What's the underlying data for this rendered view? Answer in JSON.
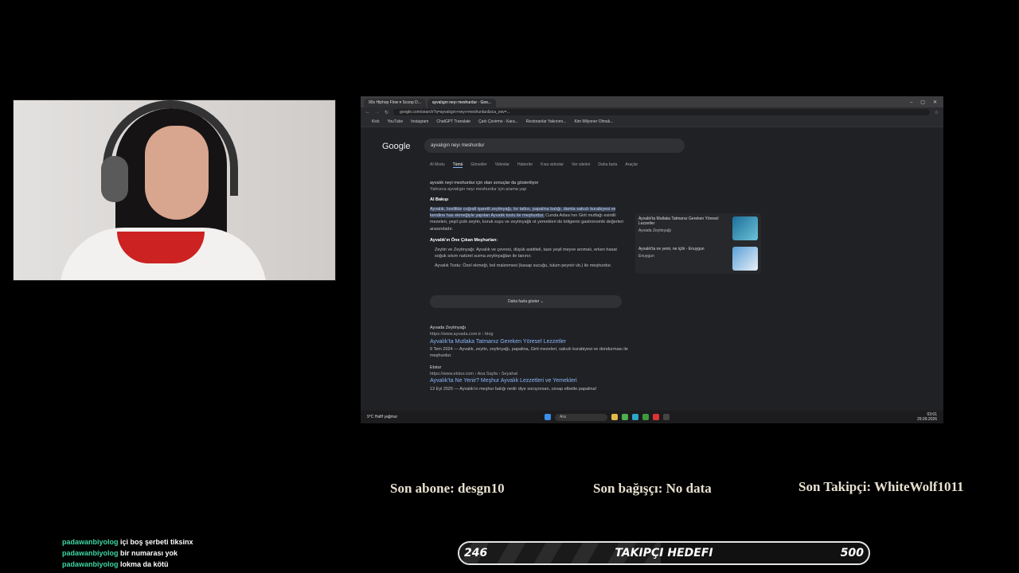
{
  "stream": {
    "last_sub": "Son abone: desgn10",
    "last_donor": "Son bağışçı: No data",
    "last_follower": "Son Takipçi: WhiteWolf1011",
    "goal": {
      "current": "246",
      "title": "TAKIPÇI HEDEFI",
      "target": "500",
      "progress": 0.492
    },
    "chat": [
      {
        "user": "padawanbiyolog",
        "msg": "içi boş şerbeti tiksinx"
      },
      {
        "user": "padawanbiyolog",
        "msg": "bir numarası yok"
      },
      {
        "user": "padawanbiyolog",
        "msg": "lokma da kötü"
      }
    ]
  },
  "browser": {
    "tabs": [
      "90s Hiphop Flow ▾ Scoop D...",
      "ayvalıgın neyı meshurdur - Goo..."
    ],
    "url": "google.com/search?q=ayvalıgın+neyı+meshurdur&sca_esv=...",
    "bookmarks": [
      "Kick",
      "YouTube",
      "Instagram",
      "ChatGPT Translate",
      "Çarlı Çevirme - Kara...",
      "Restoranlar Yakınımı...",
      "Kim Milyoner Olmak..."
    ],
    "search_query": "ayvalıgın neyı meshurdur",
    "logo": "Google",
    "search_tabs": [
      "AI Modu",
      "Tümü",
      "Görseller",
      "Videolar",
      "Haberler",
      "Kısa videolar",
      "Ver siteleri",
      "Daha fazla",
      "Araçlar"
    ],
    "correction": "ayvalık neyi meshurdur için olan sonuçlar da gösteriliyor",
    "correction_sub": "Yalnızca ayvalıgın neyı meshurdur için arama yap",
    "ai_label": "AI Bakışı",
    "ai_text_1": "Ayvalık, özellikle coğrafi işaretli zeytinyağı, lor tatlısı, papalina balığı, damla sakızlı kurabiyesi ve kendine has ekmeğiyle yapılan Ayvalık tostu ile meşhurdur.",
    "ai_text_2": "Cunda Adası'nın Girit mutfağı esintili mezeleri, yeşil çizik zeytin, koruk suyu ve zeytinyağlı ot yemekleri de bölgenin gastronomik değerleri arasındadır.",
    "famous_heading": "Ayvalık'ın Öne Çıkan Meşhurları:",
    "bullet_1": "Zeytin ve Zeytinyağı: Ayvalık ve çevresi, düşük asiditeli, taze yeşil meyve aromalı, erken hasat soğuk sıkım natürel sızma zeytinyağları ile tanınır.",
    "bullet_2": "Ayvalık Tostu: Özel ekmeği, bol malzemesi (kasap sucuğu, tulum peyniri vb.) ile meşhurdur.",
    "more_button": "Daha fazla göster",
    "side_1_title": "Ayvalık'ta Mutlaka Tatmanız Gereken Yöresel Lezzetler",
    "side_1_source": "Ayvada Zeytinyağı",
    "side_2_title": "Ayvalık'ta ne yenir, ne içilir - Enuygun",
    "side_2_source": "Enuygun",
    "result_1_site": "Ayvada Zeytinyağı",
    "result_1_url": "https://www.ayvada.com.tr › blog",
    "result_1_title": "Ayvalık'ta Mutlaka Tatmanız Gereken Yöresel Lezzetler",
    "result_1_snippet": "9 Tem 2024 — Ayvalık, zeytin, zeytinyağı, papalina, Girit mezeleri, sakızlı kurabiyesi ve dondurması ile meşhurdur.",
    "result_2_site": "Etstur",
    "result_2_url": "https://www.etstur.com › Ana Sayfa › Seyahat",
    "result_2_title": "Ayvalık'ta Ne Yenir? Meşhur Ayvalık Lezzetleri ve Yemekleri",
    "result_2_snippet": "13 Eyl 2025 — Ayvalık'ın meşhur balığı nedir diye soruyorsan, cevap elbette papalina!",
    "weather": "9°C Hafif yağmur",
    "taskbar_search": "Ara",
    "clock_time": "03:01",
    "clock_date": "29.09.2026"
  }
}
